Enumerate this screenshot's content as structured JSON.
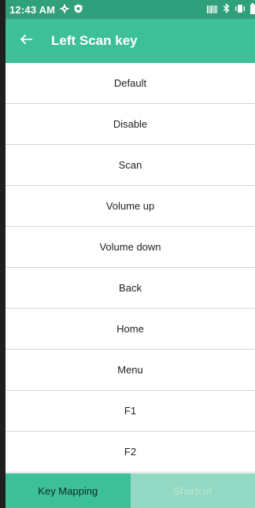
{
  "status_bar": {
    "time": "12:43 AM",
    "icons": [
      "gear-icon",
      "shield-icon",
      "barcode-icon",
      "bluetooth-icon",
      "vibrate-icon",
      "battery-icon"
    ]
  },
  "app_bar": {
    "title": "Left Scan key",
    "back_icon": "back-arrow-icon"
  },
  "options": [
    "Default",
    "Disable",
    "Scan",
    "Volume up",
    "Volume down",
    "Back",
    "Home",
    "Menu",
    "F1",
    "F2"
  ],
  "bottom_tabs": {
    "key_mapping": "Key Mapping",
    "shortcut": "Shortcut"
  },
  "colors": {
    "status_bar": "#2f9f7c",
    "app_bar": "#3dbf97",
    "tab_active": "#3dbf97",
    "tab_inactive": "#93d8c2"
  }
}
